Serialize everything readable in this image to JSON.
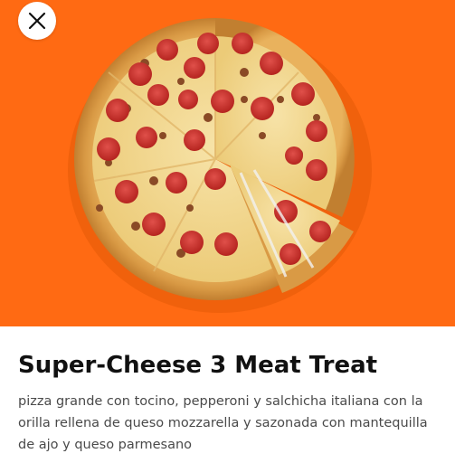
{
  "product": {
    "title": "Super-Cheese 3 Meat Treat",
    "description": "pizza grande con tocino, pepperoni y salchicha italiana con la orilla rellena de queso mozzarella y sazonada con mantequilla de ajo y queso parmesano"
  },
  "hero": {
    "background_color": "#ff6a13",
    "image": "pizza-image"
  },
  "close_button": {
    "icon": "close-icon"
  }
}
